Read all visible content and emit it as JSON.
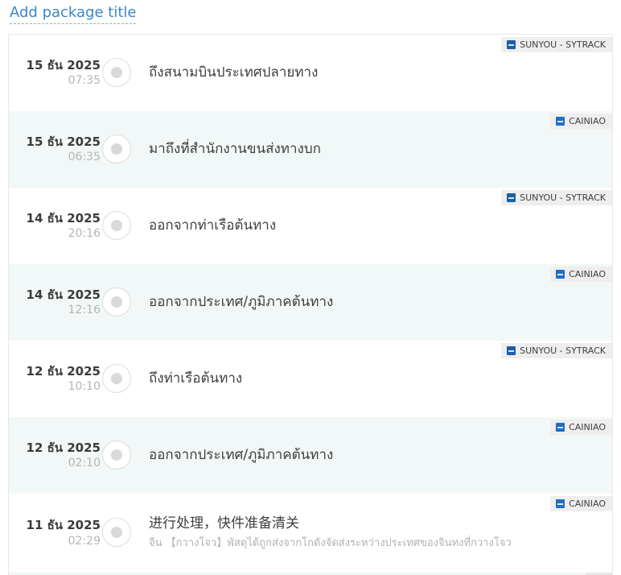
{
  "page": {
    "title": "Add package title"
  },
  "colors": {
    "accent": "#3c87c6",
    "alt_row_bg": "#f2f8f7",
    "badge_bg": "#eeeeee",
    "sunyou_icon_blue": "#1b5fa8",
    "cainiao_icon_blue": "#1e6fc4",
    "text": "#3e3e3e",
    "muted": "#b5b5b5",
    "timeline_line": "#e3e3e3"
  },
  "timeline": {
    "events": [
      {
        "date": "15 ธัน 2025",
        "time": "07:35",
        "text": "ถึงสนามบินประเทศปลายทาง",
        "carrier": "SUNYOU - SYTRACK"
      },
      {
        "date": "15 ธัน 2025",
        "time": "06:35",
        "text": "มาถึงที่สำนักงานขนส่งทางบก",
        "carrier": "CAINIAO"
      },
      {
        "date": "14 ธัน 2025",
        "time": "20:16",
        "text": "ออกจากท่าเรือต้นทาง",
        "carrier": "SUNYOU - SYTRACK"
      },
      {
        "date": "14 ธัน 2025",
        "time": "12:16",
        "text": "ออกจากประเทศ/ภูมิภาคต้นทาง",
        "carrier": "CAINIAO"
      },
      {
        "date": "12 ธัน 2025",
        "time": "10:10",
        "text": "ถึงท่าเรือต้นทาง",
        "carrier": "SUNYOU - SYTRACK"
      },
      {
        "date": "12 ธัน 2025",
        "time": "02:10",
        "text": "ออกจากประเทศ/ภูมิภาคต้นทาง",
        "carrier": "CAINIAO"
      },
      {
        "date": "11 ธัน 2025",
        "time": "02:29",
        "text": "进行处理，快件准备清关",
        "subtext": "จีน 【กวางโจว】พัสดุได้ถูกส่งจากโกดังจัดส่งระหว่างประเทศของจินทงที่กวางโจว",
        "carrier": "CAINIAO"
      }
    ]
  }
}
